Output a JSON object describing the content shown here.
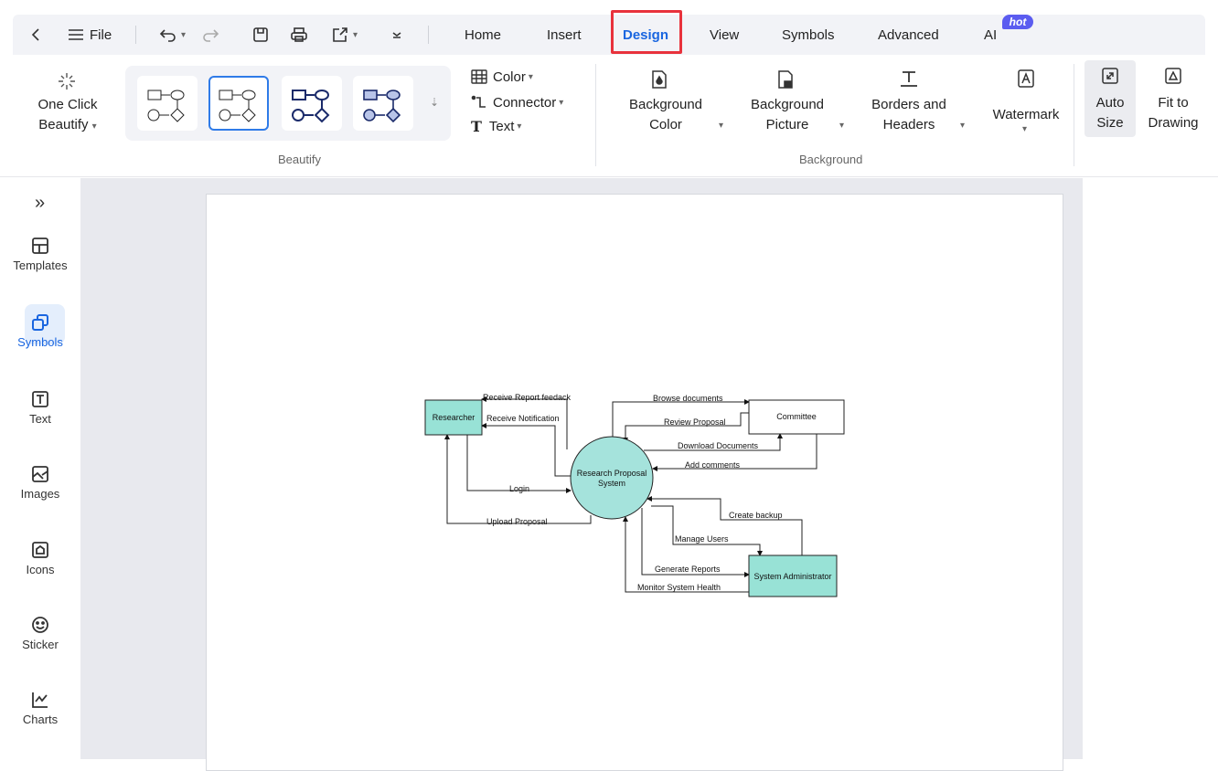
{
  "menubar": {
    "file_label": "File",
    "tabs": [
      {
        "label": "Home"
      },
      {
        "label": "Insert"
      },
      {
        "label": "Design",
        "active": true
      },
      {
        "label": "View"
      },
      {
        "label": "Symbols"
      },
      {
        "label": "Advanced"
      },
      {
        "label": "AI",
        "badge": "hot"
      }
    ]
  },
  "ribbon": {
    "one_click": {
      "line1": "One Click",
      "line2": "Beautify"
    },
    "beautify_label": "Beautify",
    "format": {
      "color": "Color",
      "connector": "Connector",
      "text": "Text"
    },
    "background": {
      "bg_color": {
        "line1": "Background",
        "line2": "Color"
      },
      "bg_picture": {
        "line1": "Background",
        "line2": "Picture"
      },
      "borders": {
        "line1": "Borders and",
        "line2": "Headers"
      },
      "watermark": "Watermark"
    },
    "background_label": "Background",
    "auto_size": {
      "line1": "Auto",
      "line2": "Size"
    },
    "fit": {
      "line1": "Fit to",
      "line2": "Drawing"
    }
  },
  "sidebar": {
    "items": [
      {
        "label": "Templates",
        "icon": "templates-icon"
      },
      {
        "label": "Symbols",
        "icon": "symbols-icon",
        "active": true
      },
      {
        "label": "Text",
        "icon": "text-icon"
      },
      {
        "label": "Images",
        "icon": "images-icon"
      },
      {
        "label": "Icons",
        "icon": "icons-icon"
      },
      {
        "label": "Sticker",
        "icon": "sticker-icon"
      },
      {
        "label": "Charts",
        "icon": "charts-icon"
      }
    ]
  },
  "diagram": {
    "nodes": {
      "researcher": "Researcher",
      "committee": "Committee",
      "process_line1": "Research Proposal",
      "process_line2": "System",
      "admin": "System Administrator"
    },
    "flows": {
      "receive_report": "Receive Report feedack",
      "receive_notification": "Receive Notification",
      "login": "Login",
      "upload": "Upload Proposal",
      "browse": "Browse documents",
      "review": "Review Proposal",
      "download": "Download Documents",
      "comments": "Add comments",
      "backup": "Create backup",
      "manage": "Manage Users",
      "reports": "Generate Reports",
      "monitor": "Monitor System Health"
    },
    "colors": {
      "entity_fill": "#98e2d6",
      "process_fill": "#a5e3dc"
    }
  },
  "colors": {
    "accent": "#1a66e0",
    "highlight": "#e8323c",
    "hot_badge": "#5b5cf0"
  }
}
